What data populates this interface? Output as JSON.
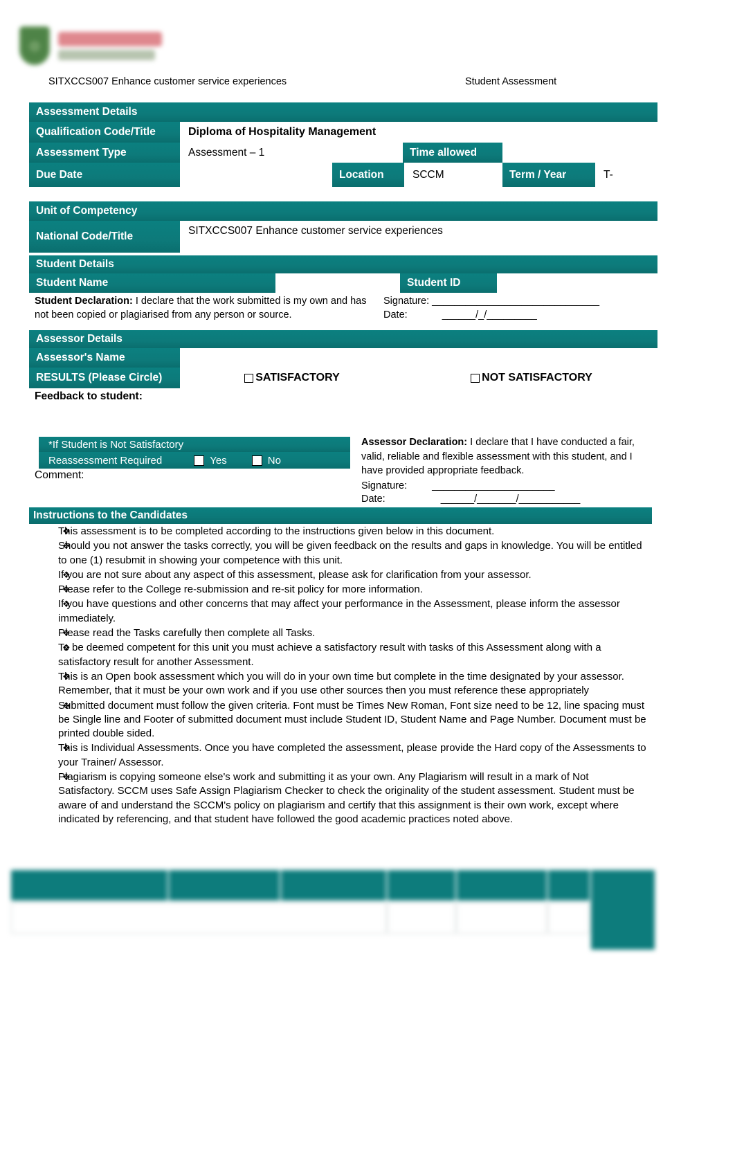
{
  "header": {
    "unit_title": "SITXCCS007 Enhance customer service experiences",
    "doc_type": "Student Assessment",
    "logo_name": "college-logo"
  },
  "assessment_details": {
    "section_title": "Assessment Details",
    "qualification_label": "Qualification Code/Title",
    "qualification_value": "Diploma of Hospitality Management",
    "type_label": "Assessment Type",
    "type_value": "Assessment – 1",
    "time_allowed_label": "Time allowed",
    "time_allowed_value": "",
    "due_date_label": "Due Date",
    "due_date_value": "",
    "location_label": "Location",
    "location_value": "SCCM",
    "term_year_label": "Term / Year",
    "term_year_value": "T-"
  },
  "unit_of_competency": {
    "section_title": "Unit of Competency",
    "national_code_label": "National Code/Title",
    "national_code_value": "SITXCCS007 Enhance customer service experiences"
  },
  "student_details": {
    "section_title": "Student Details",
    "student_name_label": "Student Name",
    "student_name_value": "",
    "student_id_label": "Student ID",
    "student_id_value": "",
    "declaration_label": "Student Declaration:",
    "declaration_text": "I declare that the work submitted is my own and has not been copied or plagiarised from any person or source.",
    "signature_label": "Signature:",
    "signature_line": "______________________________",
    "date_label": "Date:",
    "date_line": "______/_/_________"
  },
  "assessor_details": {
    "section_title": "Assessor Details",
    "assessor_name_label": "Assessor's Name",
    "assessor_name_value": "",
    "results_label": "RESULTS (Please Circle)",
    "result_satisfactory": "SATISFACTORY",
    "result_not_satisfactory": "NOT SATISFACTORY",
    "feedback_label": "Feedback to student:",
    "feedback_value": ""
  },
  "reassessment": {
    "heading": "*If Student is Not Satisfactory",
    "required_label": "Reassessment Required",
    "yes_label": "Yes",
    "no_label": "No",
    "comment_label": "Comment:",
    "comment_value": ""
  },
  "assessor_declaration": {
    "label": "Assessor Declaration:",
    "text": "I declare that I have conducted a fair, valid, reliable and flexible assessment with this student, and I have provided appropriate feedback.",
    "signature_label": "Signature:",
    "signature_line": "______________________",
    "date_label": "Date:",
    "date_line": "______/_______/___________"
  },
  "instructions": {
    "section_title": "Instructions to the Candidates",
    "bullet_glyph": "❖",
    "items": [
      "This assessment is to be completed according to the instructions given below in this document.",
      "Should you not answer the tasks correctly, you will be given feedback on the results and gaps in knowledge. You will be entitled to one (1) resubmit in showing your competence with this unit.",
      "If you are not sure about any aspect of this assessment, please ask for clarification from your assessor.",
      "Please refer to the College re-submission and re-sit policy for more information.",
      "If you have questions and other concerns that may affect your performance in the Assessment, please inform the assessor immediately.",
      "Please read the Tasks carefully then complete all Tasks.",
      "To be deemed competent for this unit you must achieve a satisfactory result with tasks of this Assessment along with a satisfactory result for another Assessment.",
      "This is an Open book assessment which you will do in your own time but complete in the time designated by your assessor. Remember, that it must be your own work and if you use other sources then you must reference these appropriately",
      "Submitted document must follow the given criteria. Font must be Times New Roman, Font size need to be 12, line spacing must be Single line and Footer of submitted document must include Student ID, Student Name and Page Number. Document must be printed double sided.",
      "This is Individual Assessments. Once you have completed the assessment, please provide the Hard copy of the Assessments to your Trainer/ Assessor.",
      "Plagiarism is copying someone else's work and submitting it as your own. Any Plagiarism will result in a mark of Not Satisfactory. SCCM uses Safe Assign Plagiarism Checker to check the originality of the student assessment. Student must be aware of and understand the SCCM's policy on plagiarism and certify that this assignment is their own work, except where indicated by referencing, and that student have followed the good academic practices noted above."
    ]
  },
  "footer_table": {
    "note": "blurred-illegible",
    "row1": [
      "",
      "",
      "",
      "",
      "",
      ""
    ],
    "row2": [
      "",
      "",
      "",
      ""
    ],
    "page_label": ""
  },
  "colors": {
    "teal": "#0d7c7c",
    "teal_dark": "#0a6c6c",
    "white": "#ffffff",
    "text": "#000000"
  }
}
